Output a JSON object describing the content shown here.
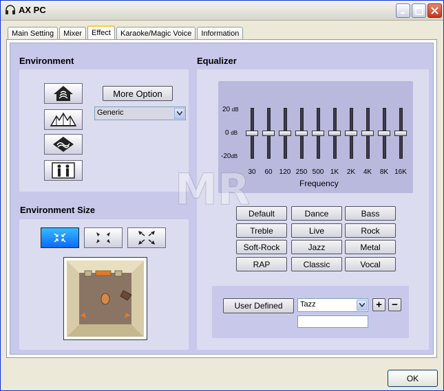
{
  "window": {
    "title": "AX PC"
  },
  "tabs": [
    {
      "label": "Main Setting"
    },
    {
      "label": "Mixer"
    },
    {
      "label": "Effect"
    },
    {
      "label": "Karaoke/Magic Voice"
    },
    {
      "label": "Information"
    }
  ],
  "environment": {
    "label": "Environment",
    "more_option": "More Option",
    "preset": "Generic",
    "icons": [
      "house-icon",
      "concert-hall-icon",
      "cave-icon",
      "room-people-icon"
    ]
  },
  "environment_size": {
    "label": "Environment Size",
    "selected_index": 0
  },
  "equalizer": {
    "label": "Equalizer",
    "db_top": "20",
    "db_mid": "0",
    "db_bottom": "-20",
    "db_unit": "dB",
    "frequency_label": "Frequency",
    "bands": [
      {
        "freq": "30",
        "level": 0
      },
      {
        "freq": "60",
        "level": 0
      },
      {
        "freq": "120",
        "level": 0
      },
      {
        "freq": "250",
        "level": 0
      },
      {
        "freq": "500",
        "level": 0
      },
      {
        "freq": "1K",
        "level": 0
      },
      {
        "freq": "2K",
        "level": 0
      },
      {
        "freq": "4K",
        "level": 0
      },
      {
        "freq": "8K",
        "level": 0
      },
      {
        "freq": "16K",
        "level": 0
      }
    ],
    "presets": [
      "Default",
      "Dance",
      "Bass",
      "Treble",
      "Live",
      "Rock",
      "Soft-Rock",
      "Jazz",
      "Metal",
      "RAP",
      "Classic",
      "Vocal"
    ]
  },
  "user_defined": {
    "button": "User  Defined",
    "selected": "Tazz",
    "name_value": "",
    "add": "+",
    "remove": "−"
  },
  "footer": {
    "ok": "OK"
  },
  "colors": {
    "panel": "#c8c9ea",
    "accent": "#1e90ff"
  }
}
